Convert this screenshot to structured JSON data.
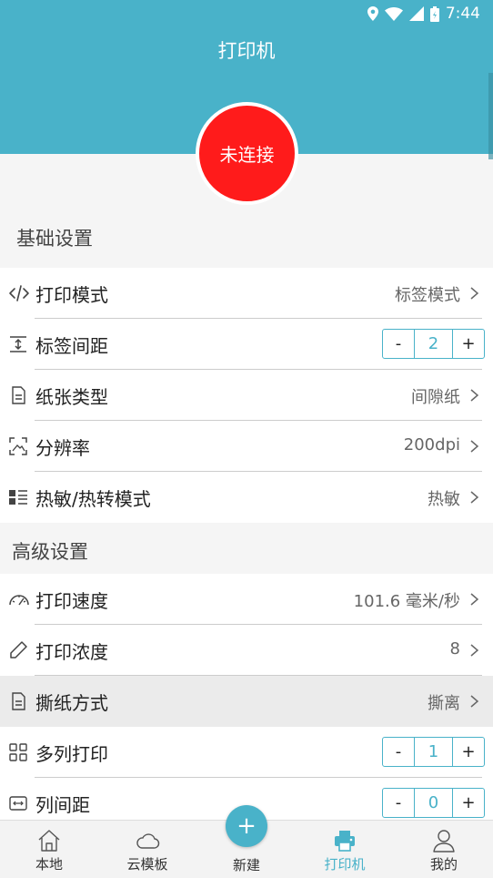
{
  "status_bar": {
    "time": "7:44"
  },
  "header": {
    "title": "打印机"
  },
  "connection": {
    "label": "未连接"
  },
  "sections": {
    "basic": "基础设置",
    "advanced": "高级设置"
  },
  "rows": {
    "print_mode": {
      "label": "打印模式",
      "value": "标签模式",
      "icon": "code-icon"
    },
    "label_gap": {
      "label": "标签间距",
      "value": "2",
      "icon": "gap-icon"
    },
    "paper_type": {
      "label": "纸张类型",
      "value": "间隙纸",
      "icon": "document-icon"
    },
    "resolution": {
      "label": "分辨率",
      "value": "200dpi",
      "icon": "resolution-icon"
    },
    "thermal_mode": {
      "label": "热敏/热转模式",
      "value": "热敏",
      "icon": "list-icon"
    },
    "print_speed": {
      "label": "打印速度",
      "value": "101.6 毫米/秒",
      "icon": "speedometer-icon"
    },
    "print_density": {
      "label": "打印浓度",
      "value": "8",
      "icon": "pencil-icon"
    },
    "tear_mode": {
      "label": "撕纸方式",
      "value": "撕离",
      "icon": "document-icon"
    },
    "multi_column": {
      "label": "多列打印",
      "value": "1",
      "icon": "grid-icon"
    },
    "column_gap": {
      "label": "列间距",
      "value": "0",
      "icon": "column-gap-icon"
    }
  },
  "stepper": {
    "minus": "-",
    "plus": "+"
  },
  "tabbar": {
    "local": "本地",
    "cloud": "云模板",
    "new": "新建",
    "new_symbol": "+",
    "printer": "打印机",
    "mine": "我的"
  },
  "colors": {
    "accent": "#49b2c9",
    "disconnected": "#ff1b1b"
  }
}
